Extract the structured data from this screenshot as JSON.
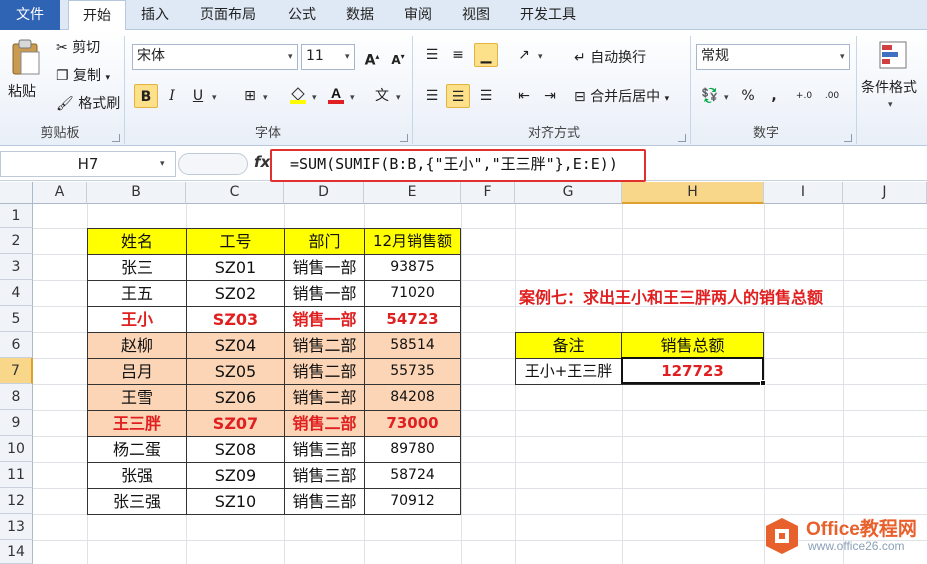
{
  "tabs": [
    "文件",
    "开始",
    "插入",
    "页面布局",
    "公式",
    "数据",
    "审阅",
    "视图",
    "开发工具"
  ],
  "clipboard": {
    "paste": "粘贴",
    "cut": "剪切",
    "copy": "复制",
    "format_painter": "格式刷",
    "group": "剪贴板"
  },
  "font": {
    "name": "宋体",
    "size": "11",
    "group": "字体",
    "bold": "B",
    "italic": "I",
    "underline": "U"
  },
  "alignment": {
    "wrap": "自动换行",
    "merge": "合并后居中",
    "group": "对齐方式"
  },
  "number": {
    "format": "常规",
    "percent": "%",
    "comma": ",",
    "group": "数字"
  },
  "styles": {
    "conditional": "条件格式"
  },
  "formula_bar": {
    "name_box": "H7",
    "fx": "fx",
    "formula": "=SUM(SUMIF(B:B,{\"王小\",\"王三胖\"},E:E))"
  },
  "columns": [
    "A",
    "B",
    "C",
    "D",
    "E",
    "F",
    "G",
    "H",
    "I",
    "J"
  ],
  "rows": [
    "1",
    "2",
    "3",
    "4",
    "5",
    "6",
    "7",
    "8",
    "9",
    "10",
    "11",
    "12",
    "13",
    "14"
  ],
  "table": {
    "headers": [
      "姓名",
      "工号",
      "部门",
      "12月销售额"
    ],
    "rows": [
      [
        "张三",
        "SZ01",
        "销售一部",
        "93875"
      ],
      [
        "王五",
        "SZ02",
        "销售一部",
        "71020"
      ],
      [
        "王小",
        "SZ03",
        "销售一部",
        "54723"
      ],
      [
        "赵柳",
        "SZ04",
        "销售二部",
        "58514"
      ],
      [
        "吕月",
        "SZ05",
        "销售二部",
        "55735"
      ],
      [
        "王雪",
        "SZ06",
        "销售二部",
        "84208"
      ],
      [
        "王三胖",
        "SZ07",
        "销售二部",
        "73000"
      ],
      [
        "杨二蛋",
        "SZ08",
        "销售三部",
        "89780"
      ],
      [
        "张强",
        "SZ09",
        "销售三部",
        "58724"
      ],
      [
        "张三强",
        "SZ10",
        "销售三部",
        "70912"
      ]
    ]
  },
  "caption": "案例七：求出王小和王三胖两人的销售总额",
  "summary": {
    "h1": "备注",
    "h2": "销售总额",
    "label": "王小+王三胖",
    "value": "127723"
  },
  "logo": {
    "name": "Office教程网",
    "url": "www.office26.com"
  },
  "colors": {
    "header_yellow": "#ffff00",
    "highlight_orange": "#fbd5b5",
    "emphasis_red": "#e02020",
    "selection_gold": "#f8d78a"
  }
}
